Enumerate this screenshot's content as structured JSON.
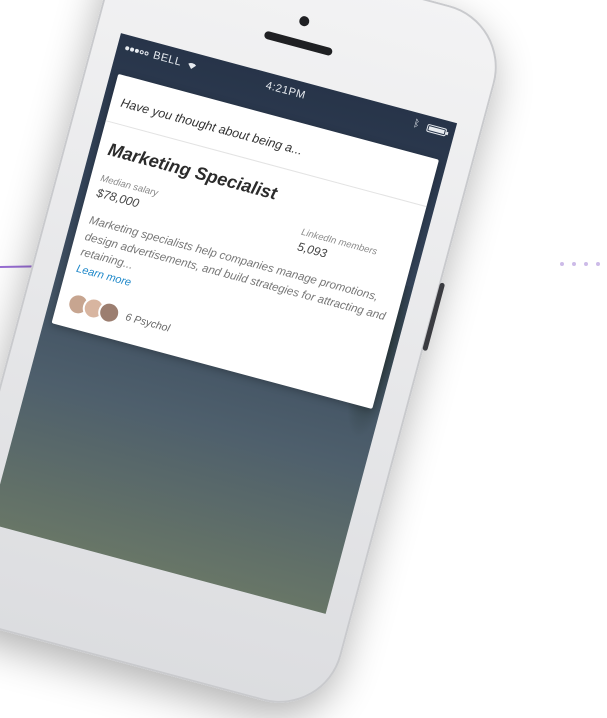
{
  "decor": {
    "accent_line_color": "#9a6fd6",
    "dot_color": "#cdbbe8"
  },
  "status_bar": {
    "carrier": "BELL",
    "time": "4:21PM",
    "signal_icon": "signal-dots-icon",
    "wifi_icon": "wifi-icon",
    "bluetooth_icon": "bluetooth-icon",
    "battery_icon": "battery-icon"
  },
  "card": {
    "prompt": "Have you thought about being a...",
    "job_title": "Marketing Specialist",
    "stats": {
      "salary_label": "Median salary",
      "salary_value": "$78,000",
      "members_label": "LinkedIn members",
      "members_value": "5,093"
    },
    "description": "Marketing specialists help companies manage promotions, design advertisements, and build strategies for attracting and retaining...",
    "learn_more": "Learn more",
    "footer_text": "6 Psychol"
  },
  "colors": {
    "link": "#1f88c9",
    "screen_top": "#273449"
  }
}
